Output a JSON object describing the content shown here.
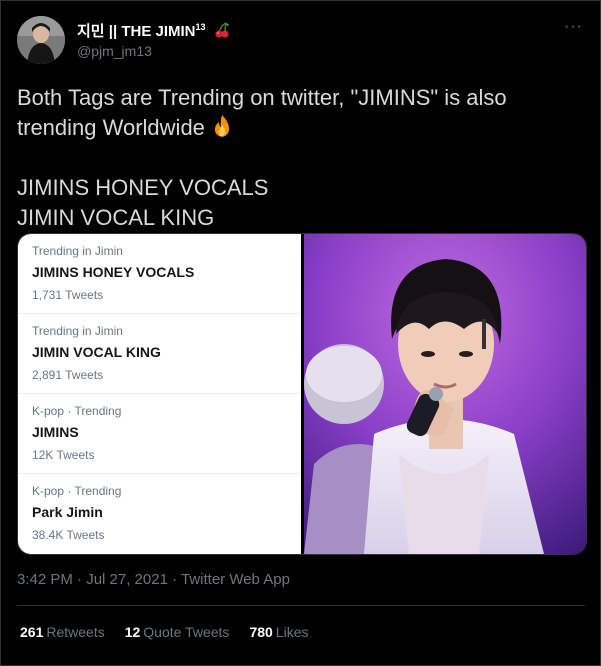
{
  "author": {
    "display_name": "지민 || THE JIMIN",
    "superscript": "13",
    "handle": "@pjm_jm13",
    "emoji": "cherries"
  },
  "more_label": "···",
  "tweet": {
    "line1": "Both Tags are Trending on twitter, \"JIMINS\" is also trending Worldwide",
    "line2": "JIMINS HONEY VOCALS",
    "line3": "JIMIN VOCAL KING"
  },
  "trends": [
    {
      "context": "Trending in Jimin",
      "title": "JIMINS HONEY VOCALS",
      "count": "1,731 Tweets"
    },
    {
      "context": "Trending in Jimin",
      "title": "JIMIN VOCAL KING",
      "count": "2,891 Tweets"
    },
    {
      "context": "K-pop · Trending",
      "title": "JIMINS",
      "count": "12K Tweets"
    },
    {
      "context": "K-pop · Trending",
      "title": "Park Jimin",
      "count": "38.4K Tweets"
    }
  ],
  "meta": "3:42 PM · Jul 27, 2021 · Twitter Web App",
  "stats": {
    "retweets_count": "261",
    "retweets_label": "Retweets",
    "quotes_count": "12",
    "quotes_label": "Quote Tweets",
    "likes_count": "780",
    "likes_label": "Likes"
  },
  "colors": {
    "background": "#000000",
    "secondary_text": "#6e767d",
    "trend_card": "#ffffff"
  }
}
